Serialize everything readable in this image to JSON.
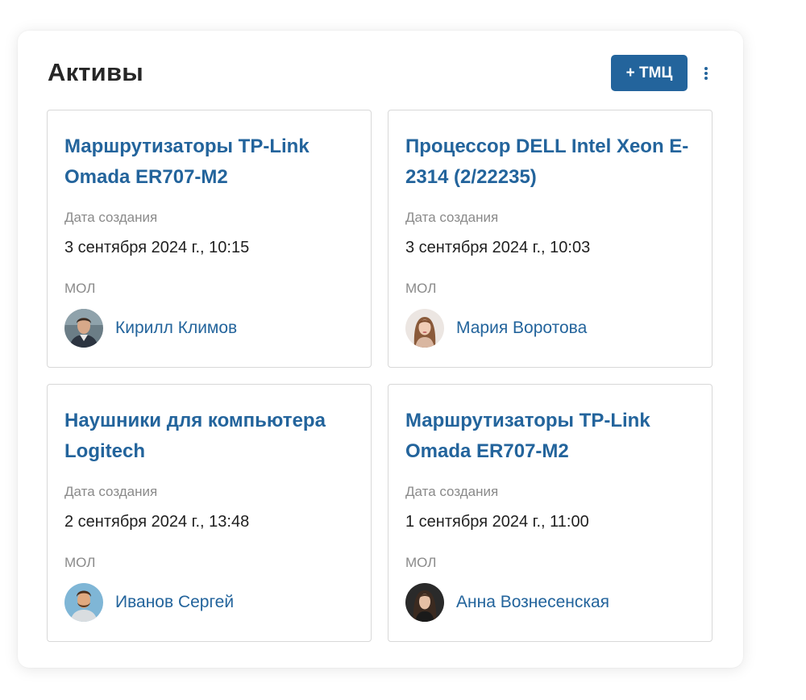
{
  "panel": {
    "title": "Активы",
    "add_button_label": "+ ТМЦ",
    "more_icon": "more-vertical-icon"
  },
  "labels": {
    "date": "Дата создания",
    "mol": "МОЛ"
  },
  "colors": {
    "accent": "#23649c",
    "title_text": "#262626",
    "label_text": "#8a8a8a",
    "border": "#d8d8d8"
  },
  "cards": [
    {
      "title": "Маршрутизаторы TP-Link Omada ER707-M2",
      "date": "3 сентября 2024 г., 10:15",
      "person": "Кирилл Климов"
    },
    {
      "title": "Процессор DELL Intel Xeon E-2314 (2/22235)",
      "date": "3 сентября 2024 г., 10:03",
      "person": "Мария Воротова"
    },
    {
      "title": "Наушники для компьютера Logitech",
      "date": "2 сентября 2024 г., 13:48",
      "person": "Иванов Сергей"
    },
    {
      "title": "Маршрутизаторы TP-Link Omada ER707-M2",
      "date": "1 сентября 2024 г., 11:00",
      "person": "Анна Вознесенская"
    }
  ]
}
